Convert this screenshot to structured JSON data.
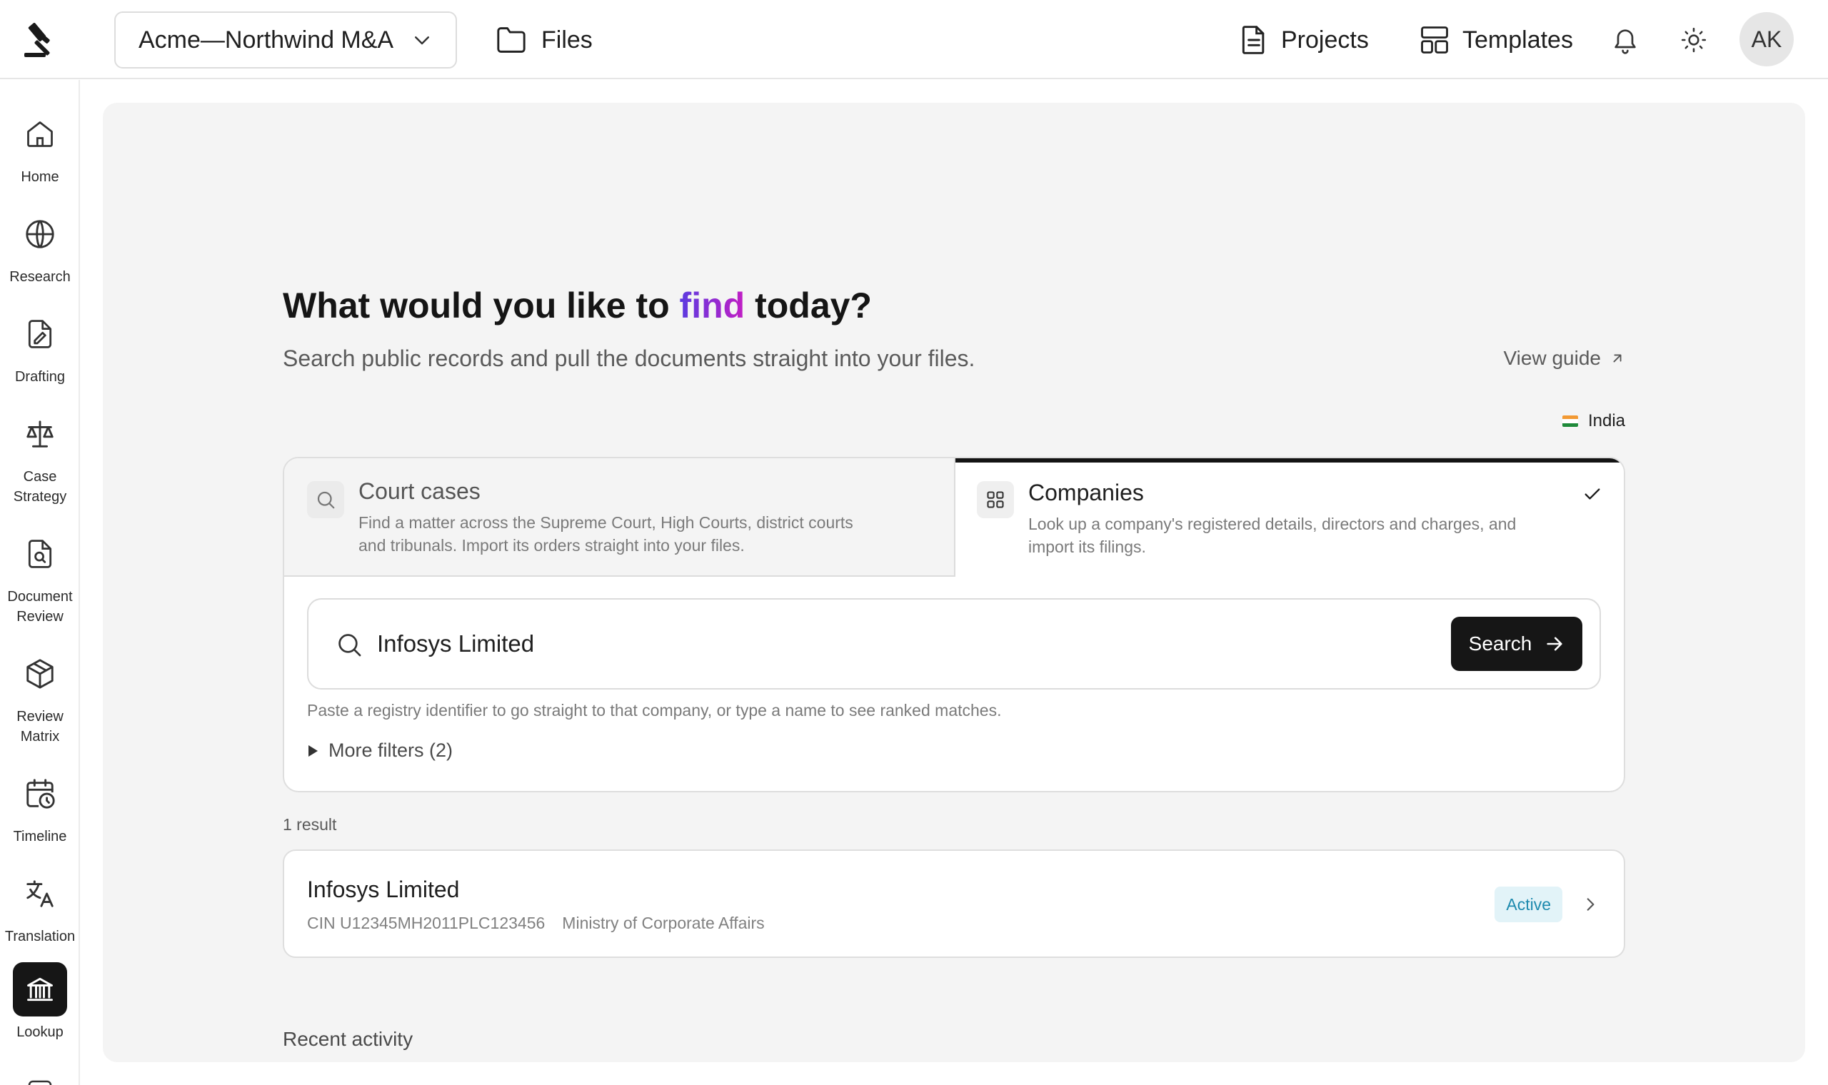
{
  "app": {
    "workspace": "Acme—Northwind M&A",
    "files_label": "Files",
    "projects_label": "Projects",
    "templates_label": "Templates",
    "avatar_initials": "AK"
  },
  "sidebar": {
    "items": [
      {
        "label": "Home",
        "icon": "home-icon"
      },
      {
        "label": "Research",
        "icon": "globe-icon"
      },
      {
        "label": "Drafting",
        "icon": "document-pen-icon"
      },
      {
        "label": "Case Strategy",
        "icon": "scales-icon"
      },
      {
        "label": "Document Review",
        "icon": "document-search-icon"
      },
      {
        "label": "Review Matrix",
        "icon": "cube-icon"
      },
      {
        "label": "Timeline",
        "icon": "calendar-clock-icon"
      },
      {
        "label": "Translation",
        "icon": "translate-icon"
      },
      {
        "label": "Lookup",
        "icon": "bank-icon",
        "active": true
      }
    ]
  },
  "page": {
    "headline_pre": "What would you like to ",
    "headline_accent": "find",
    "headline_post": " today?",
    "subtitle": "Search public records and pull the documents straight into your files.",
    "guide_label": "View guide",
    "country": "India"
  },
  "tabs": [
    {
      "title": "Court cases",
      "desc_line1": "Find a matter across the Supreme Court, High Courts, district courts",
      "desc_line2": "and tribunals. Import its orders straight into your files.",
      "selected": false
    },
    {
      "title": "Companies",
      "desc_line1": "Look up a company's registered details, directors and charges, and",
      "desc_line2": "import its filings.",
      "selected": true
    }
  ],
  "search": {
    "value": "Infosys Limited",
    "button_label": "Search",
    "hint": "Paste a registry identifier to go straight to that company, or type a name to see ranked matches.",
    "filters_label": "More filters (2)"
  },
  "results": {
    "count_label": "1 result",
    "items": [
      {
        "name": "Infosys Limited",
        "cin": "CIN U12345MH2011PLC123456",
        "registry": "Ministry of Corporate Affairs",
        "status": "Active"
      }
    ]
  },
  "recent": {
    "title": "Recent activity"
  },
  "colors": {
    "accent_start": "#5b3be0",
    "accent_end": "#c21ec4",
    "status_active_bg": "#e2f3f8",
    "status_active_text": "#1d8aae",
    "primary_button": "#161616"
  }
}
